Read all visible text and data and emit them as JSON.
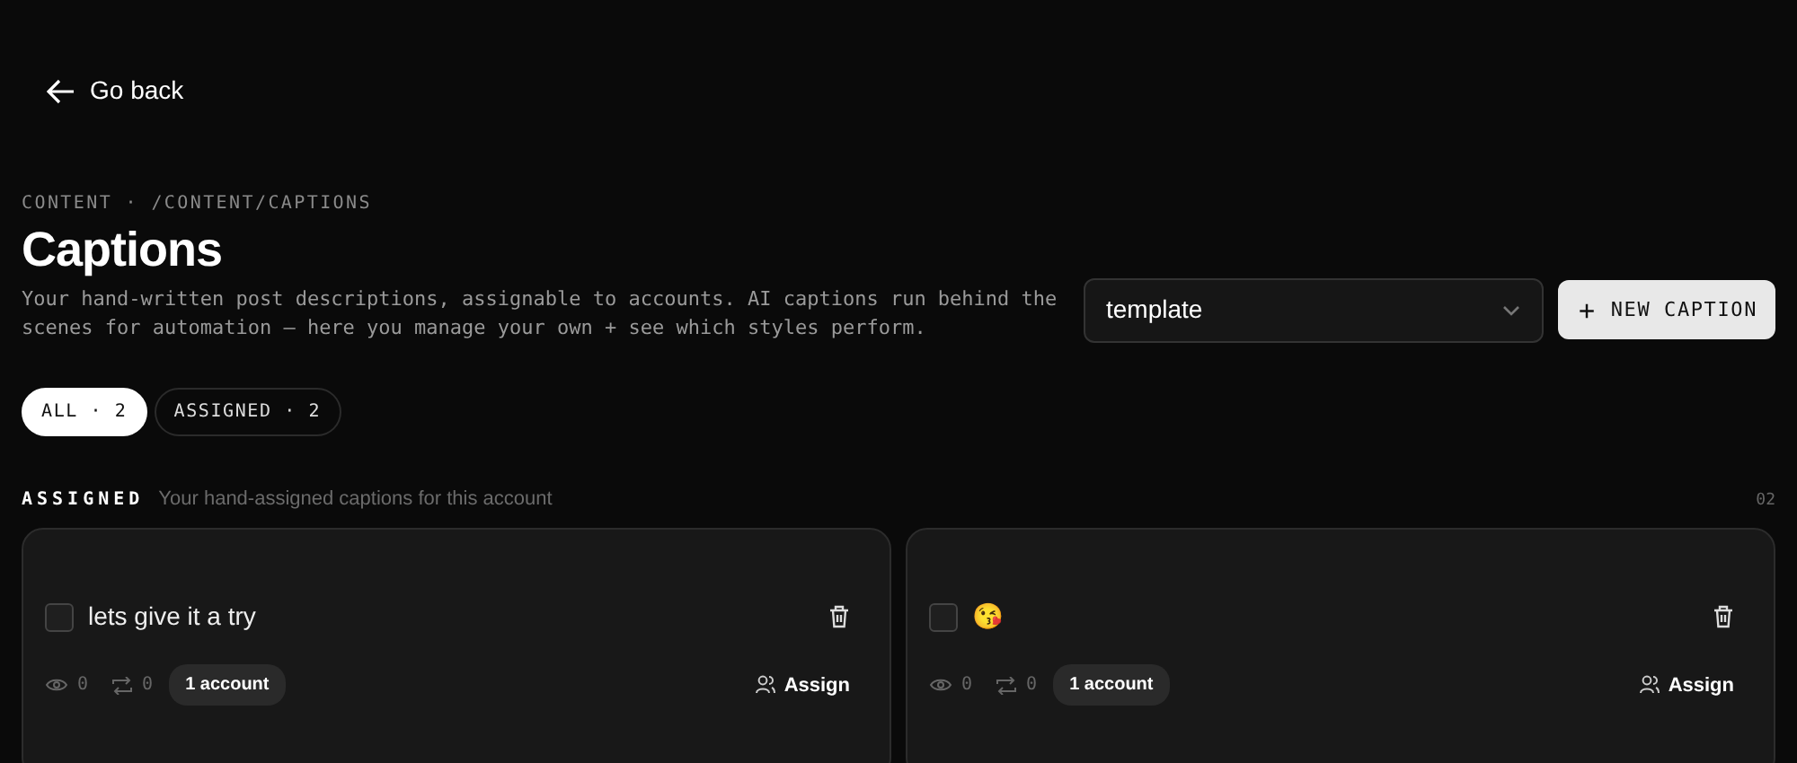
{
  "back_link": "Go back",
  "breadcrumb": "CONTENT · /CONTENT/CAPTIONS",
  "title": "Captions",
  "description": "Your hand-written post descriptions, assignable to accounts. AI captions run behind the scenes for automation — here you manage your own + see which styles perform.",
  "template_select": {
    "value": "template"
  },
  "new_button": {
    "icon": "+",
    "label": "NEW CAPTION"
  },
  "filters": [
    {
      "label": "ALL · 2",
      "selected": true
    },
    {
      "label": "ASSIGNED · 2",
      "selected": false
    }
  ],
  "section": {
    "title": "ASSIGNED",
    "subtitle": "Your hand-assigned captions for this account",
    "count": "02"
  },
  "captions": [
    {
      "text": "lets give it a try",
      "checked": false,
      "views": "0",
      "reposts": "0",
      "accounts": "1 account",
      "action": "Assign"
    },
    {
      "text": "😘",
      "checked": false,
      "views": "0",
      "reposts": "0",
      "accounts": "1 account",
      "action": "Assign"
    }
  ]
}
